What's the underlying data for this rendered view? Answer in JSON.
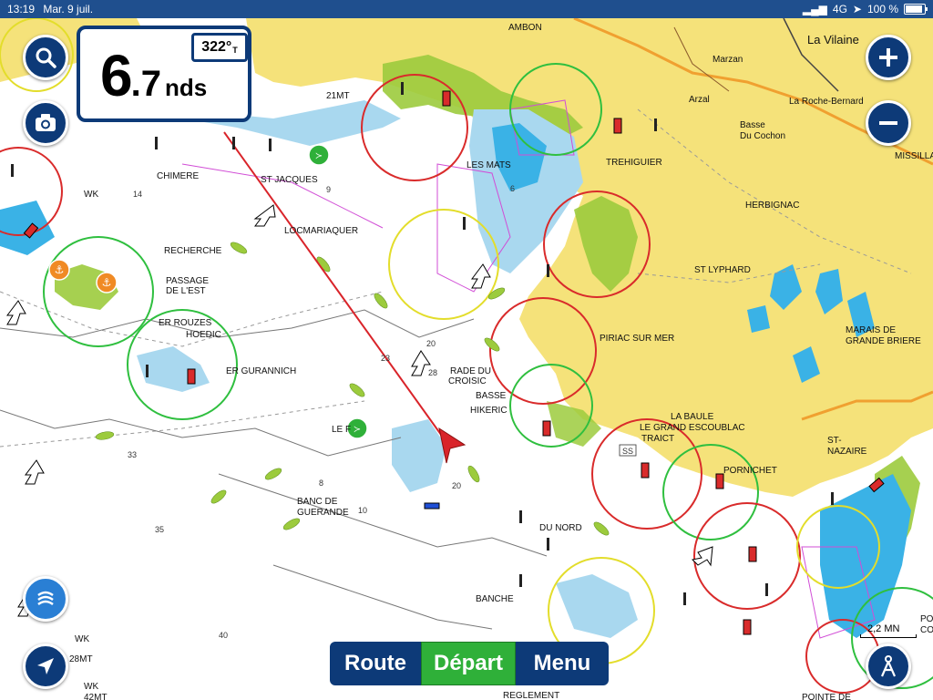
{
  "status_bar": {
    "time": "13:19",
    "date": "Mar. 9 juil.",
    "network": "4G",
    "battery": "100 %"
  },
  "speed_panel": {
    "speed_int": "6",
    "speed_dec": ".7",
    "unit": "nds",
    "heading": "322°",
    "heading_suffix": "T"
  },
  "buttons": {
    "route": "Route",
    "depart": "Départ",
    "menu": "Menu",
    "left_tools": [
      "search-icon",
      "camera-icon",
      "layers-wave-icon",
      "navigate-arrow-icon"
    ],
    "right_tools": [
      "plus-icon",
      "minus-icon",
      "compass-person-icon"
    ]
  },
  "scale": {
    "label": "2,2 MN"
  },
  "map": {
    "place_labels": {
      "la_vilaine": "La Vilaine",
      "ambon": "AMBON",
      "marzan": "Marzan",
      "arzal": "Arzal",
      "roche_bernard": "La Roche-Bernard",
      "basse_cochon_1": "Basse",
      "basse_cochon_2": "Du Cochon",
      "missillac": "MISSILLA",
      "treheguier": "TREHIGUIER",
      "herbignac": "HERBIGNAC",
      "lesmats": "LES MATS",
      "st_jacques": "ST JACQUES",
      "chimere": "CHIMERE",
      "wk1": "WK",
      "locmariaquer": "LOCMARIAQUER",
      "recherche": "RECHERCHE",
      "passage_1": "PASSAGE",
      "passage_2": "DE L'EST",
      "er_rouzes": "ER ROUZES",
      "hoedic": "HOEDIC",
      "er_guranich": "ER GURANNICH",
      "st_lyphard": "ST LYPHARD",
      "marais_1": "MARAIS DE",
      "marais_2": "GRANDE BRIERE",
      "piriac": "PIRIAC SUR MER",
      "rade_1": "RADE DU",
      "rade_2": "CROISIC",
      "basse_hikeric_1": "BASSE",
      "basse_hikeric_2": "HIKERIC",
      "la_baule_1": "LA BAULE",
      "la_baule_2": "LE GRAND ESCOUBLAC",
      "la_baule_3": "TRAICT",
      "pornichet": "PORNICHET",
      "st_nazaire_1": "ST-",
      "st_nazaire_2": "NAZAIRE",
      "le_four": "LE F",
      "banc_1": "BANC DE",
      "banc_2": "GUERANDE",
      "du_nord": "DU NORD",
      "banche": "BANCHE",
      "wk2": "WK",
      "wk3": "WK",
      "mt21": "21MT",
      "mt28": "28MT",
      "mt42": "42MT",
      "co1": "CO",
      "co2": "CO",
      "po": "PO",
      "reglement": "REGLEMENT",
      "pointe": "POINTE DE",
      "ss": "SS"
    },
    "depths": [
      "14",
      "23",
      "20",
      "33",
      "35",
      "40",
      "28",
      "20",
      "10",
      "8",
      "9",
      "6"
    ]
  },
  "colors": {
    "land": "#f5e27a",
    "shallow": "#a9d8ef",
    "deep_shallow": "#3ab2e6",
    "drying": "#9ccb3d",
    "ui_blue": "#0d3a78",
    "depart_green": "#2fb039",
    "route_line": "#d9242a"
  }
}
